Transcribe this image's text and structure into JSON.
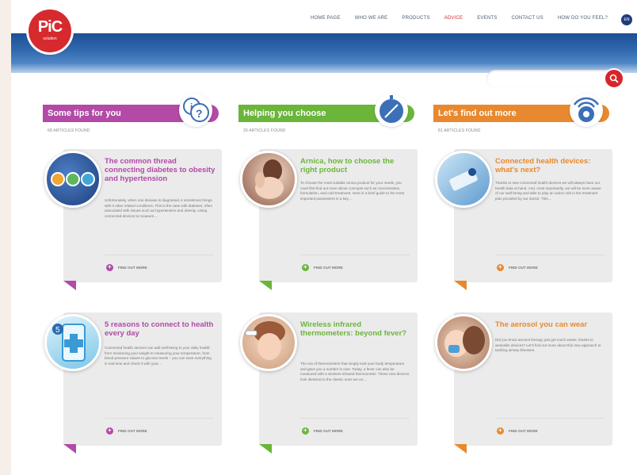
{
  "header": {
    "logo_text": "PiC",
    "logo_sub": "solution",
    "nav": [
      "HOME PAGE",
      "WHO WE ARE",
      "PRODUCTS",
      "ADVICE",
      "EVENTS",
      "CONTACT US",
      "HOW DO YOU FEEL?"
    ],
    "active_nav": "ADVICE",
    "lang": "EN",
    "search_placeholder": ""
  },
  "colors": {
    "purple": "#b24aa6",
    "green": "#6bb53a",
    "orange": "#e8892f",
    "red": "#d62a2f",
    "blue": "#1d4f95"
  },
  "columns": [
    {
      "banner": "Some tips for you",
      "count": "68 ARTICLES FOUND",
      "cards": [
        {
          "title": "The common thread connecting diabetes to obesity and hypertension",
          "body": "Unfortunately, when one disease is diagnosed, it sometimes brings with it other related conditions. This is the case with diabetes, often associated with issues such as hypertension and obesity. Using connected devices to measure…",
          "findmore": "FIND OUT MORE"
        },
        {
          "title": "5 reasons to connect to health every day",
          "body": "Connected health devices can add well-being to your daily health: from monitoring your weight to measuring your temperature, from blood pressure values to glucose levels – you can save everything in real time and check it with your…",
          "findmore": "FIND OUT MORE"
        }
      ]
    },
    {
      "banner": "Helping you choose",
      "count": "26 ARTICLES FOUND",
      "cards": [
        {
          "title": "Arnica, how to choose the right product",
          "body": "To choose the most suitable arnica product for your needs, you must first find out more about concepts such as concentration, formulation, and cold treatment. Here is a brief guide to the most important parameters in a key…",
          "findmore": "FIND OUT MORE"
        },
        {
          "title": "Wireless infrared thermometers: beyond fever?",
          "body": "The era of thermometers that simply took your body temperature and gave you a number is over. Today, a fever can also be measured with a wireless infrared thermometer. These new devices look identical to the classic ones we un…",
          "findmore": "FIND OUT MORE"
        }
      ]
    },
    {
      "banner": "Let's find out more",
      "count": "81 ARTICLES FOUND",
      "cards": [
        {
          "title": "Connected health devices: what's next?",
          "body": "Thanks to new connected health devices we will always have our health data at hand. And, most importantly, we will be more aware of our well-being and able to play an active role in the treatment plan provided by our doctor. This…",
          "findmore": "FIND OUT MORE"
        },
        {
          "title": "The aerosol you can wear",
          "body": "Did you know aerosol therapy just got much easier, thanks to wearable devices? Let's find out more about this new approach to tackling airway illnesses.",
          "findmore": "FIND OUT MORE"
        }
      ]
    }
  ]
}
